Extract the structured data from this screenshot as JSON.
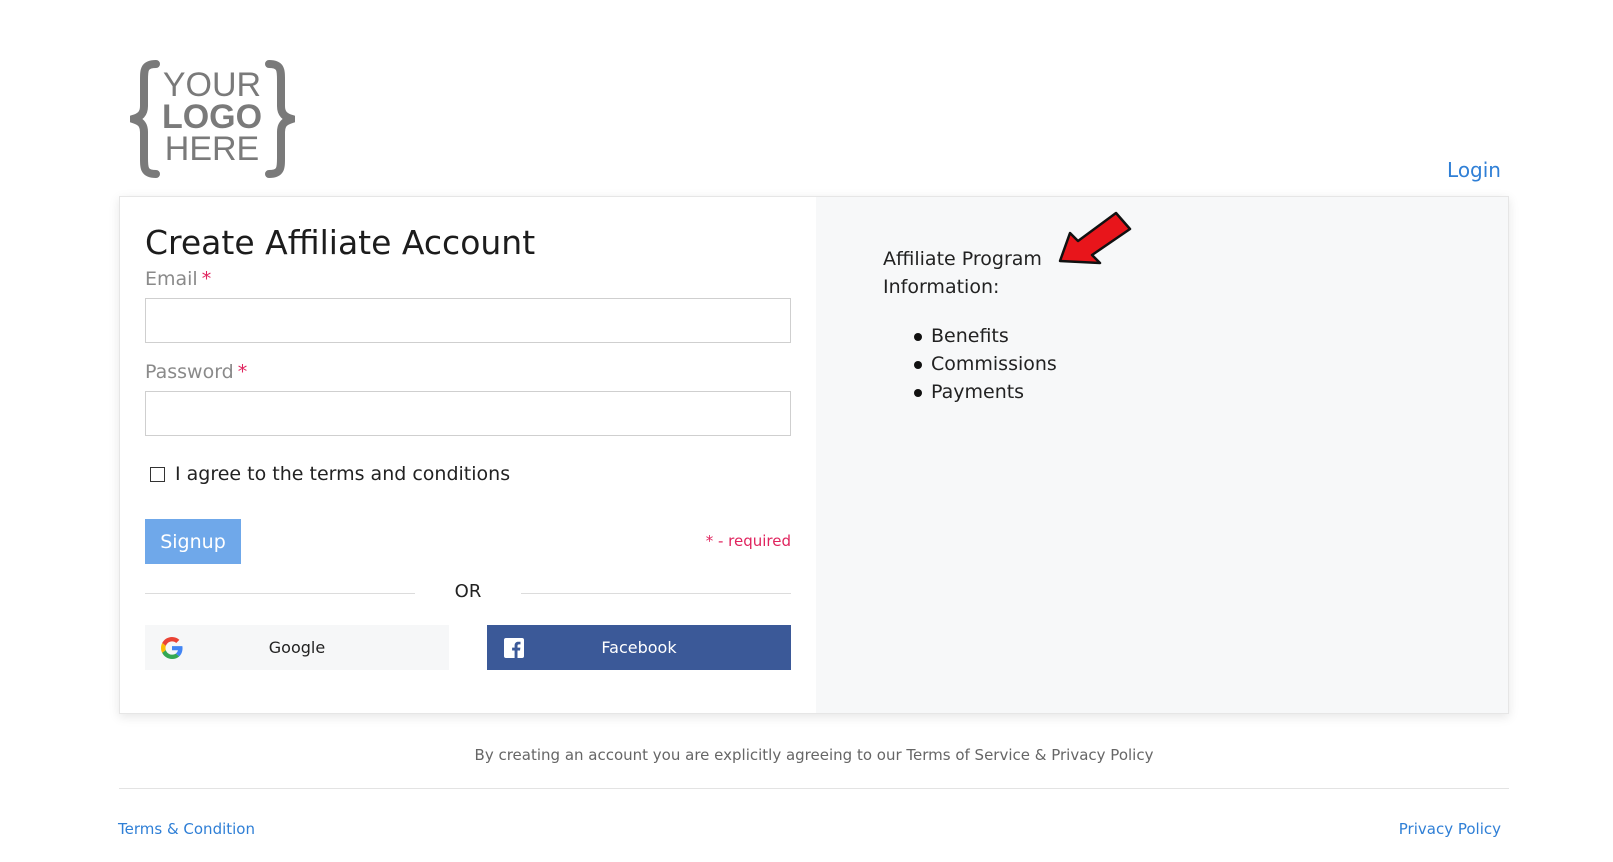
{
  "logo": {
    "line1": "YOUR",
    "line2": "LOGO",
    "line3": "HERE"
  },
  "header": {
    "login_label": "Login"
  },
  "form": {
    "title": "Create Affiliate Account",
    "email_label": "Email",
    "password_label": "Password",
    "required_marker": "*",
    "email_value": "",
    "password_value": "",
    "terms_checkbox_label": "I agree to the terms and conditions",
    "signup_label": "Signup",
    "required_note": "* - required",
    "or_label": "OR",
    "google_label": "Google",
    "facebook_label": "Facebook"
  },
  "info_panel": {
    "title": "Affiliate Program Information:",
    "items": [
      "Benefits",
      "Commissions",
      "Payments"
    ]
  },
  "footer": {
    "agreement_text": "By creating an account you are explicitly agreeing to our Terms of Service & Privacy Policy",
    "terms_link": "Terms & Condition",
    "privacy_link": "Privacy Policy"
  },
  "colors": {
    "link": "#2f7fd6",
    "signup_button": "#6fa8ea",
    "facebook": "#3b5998",
    "required": "#e0245e",
    "info_panel_bg": "#f7f8f9",
    "arrow": "#e8151b"
  }
}
